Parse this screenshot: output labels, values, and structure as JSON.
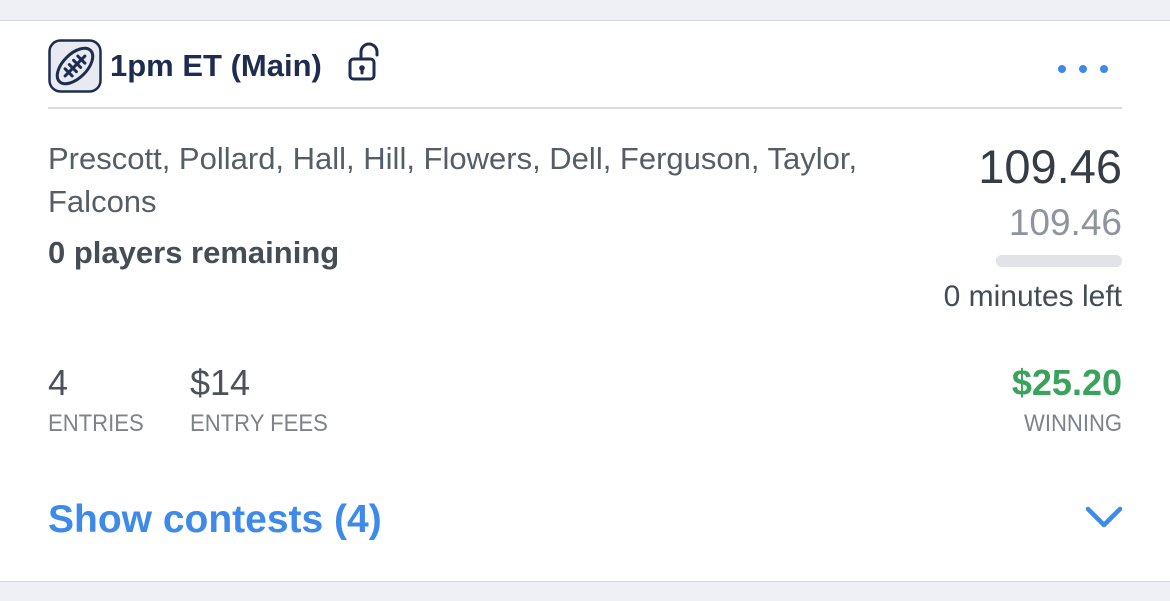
{
  "header": {
    "slate_title": "1pm ET (Main)",
    "sport_icon": "football-icon",
    "lock_icon": "unlocked-padlock-icon",
    "more_icon": "more-dots-icon"
  },
  "lineup": {
    "players": "Prescott, Pollard, Hall, Hill, Flowers, Dell, Ferguson, Taylor, Falcons",
    "players_remaining": "0 players remaining"
  },
  "scoring": {
    "points": "109.46",
    "projected_points": "109.46",
    "progress_fraction": 1.0,
    "time_left": "0 minutes left"
  },
  "stats": {
    "entries_value": "4",
    "entries_label": "ENTRIES",
    "fees_value": "$14",
    "fees_label": "ENTRY FEES",
    "winnings_value": "$25.20",
    "winnings_label": "WINNING"
  },
  "footer": {
    "show_contests_label": "Show contests (4)",
    "chevron_icon": "chevron-down-icon"
  },
  "colors": {
    "accent_blue": "#3d8ae8",
    "navy": "#1e2d4f",
    "winning_green": "#3aa35b",
    "background": "#eff0f5"
  }
}
